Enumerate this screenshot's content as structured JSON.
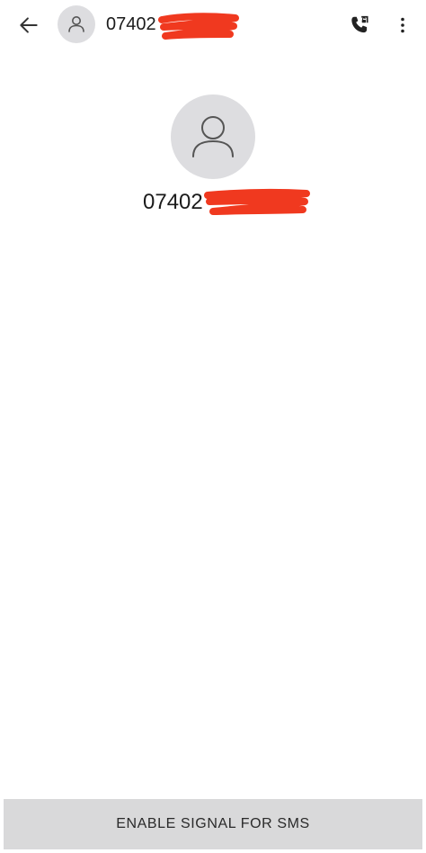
{
  "header": {
    "back_icon": "arrow-left-icon",
    "avatar_icon": "person-icon",
    "title": "07402",
    "call_icon": "phone-call-icon",
    "more_icon": "more-vertical-icon"
  },
  "profile": {
    "avatar_icon": "person-icon",
    "number": "07402"
  },
  "bottom_action": {
    "label": "ENABLE SIGNAL FOR SMS"
  },
  "colors": {
    "background": "#ffffff",
    "avatar_bg": "#dddde0",
    "redaction": "#f0391f",
    "button_bg": "#d9d9da",
    "text": "#1b1b1b"
  }
}
